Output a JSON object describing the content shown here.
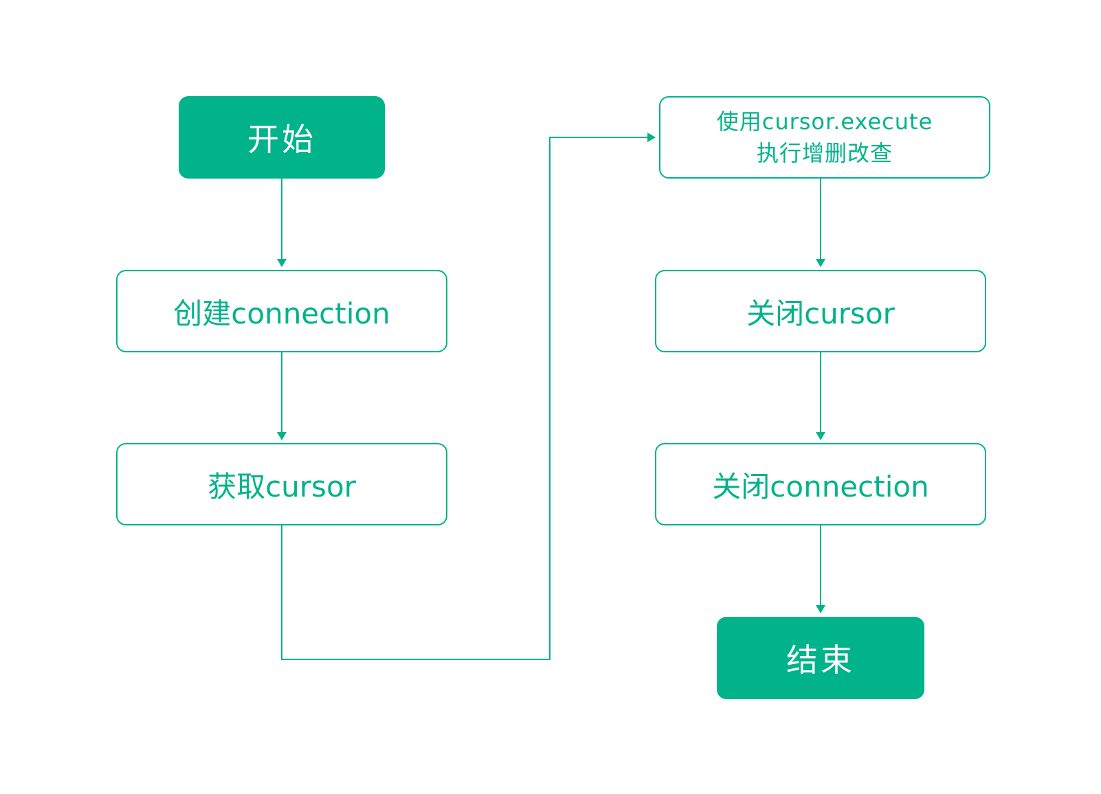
{
  "colors": {
    "accent": "#00b38a",
    "background": "#ffffff"
  },
  "nodes": {
    "start": "开始",
    "create_connection": "创建connection",
    "get_cursor": "获取cursor",
    "execute": "使用cursor.execute\n执行增删改查",
    "close_cursor": "关闭cursor",
    "close_connection": "关闭connection",
    "end": "结束"
  }
}
